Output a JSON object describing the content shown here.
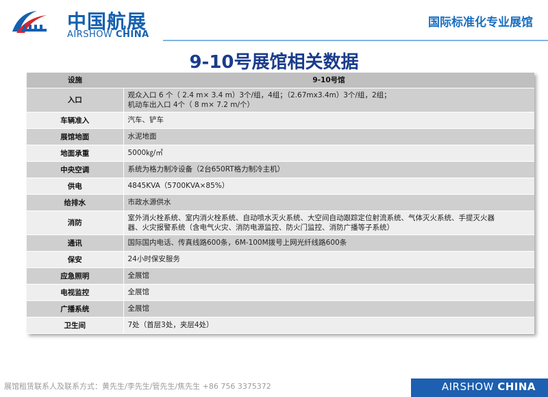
{
  "header": {
    "logo_cn": "中国航展",
    "logo_en_prefix": "AIRSHOW ",
    "logo_en_bold": "CHINA",
    "tagline": "国际标准化专业展馆"
  },
  "title": "9-10号展馆相关数据",
  "table": {
    "col_facility": "设施",
    "col_hall": "9-10号馆",
    "rows": [
      {
        "label": "入口",
        "value_lines": [
          "观众入口 6 个（ 2.4 m× 3.4 m）3个/组，4组；（2.67mx3.4m）3个/组，2组；",
          "机动车出入口 4个（ 8 m× 7.2 m/个）"
        ]
      },
      {
        "label": "车辆准入",
        "value_lines": [
          "汽车、铲车"
        ]
      },
      {
        "label": "展馆地面",
        "value_lines": [
          "水泥地面"
        ]
      },
      {
        "label": "地面承重",
        "value_lines": [
          "5000㎏/㎡"
        ]
      },
      {
        "label": "中央空调",
        "value_lines": [
          "系统为格力制冷设备（2台650RT格力制冷主机）"
        ]
      },
      {
        "label": "供电",
        "value_lines": [
          "4845KVA（5700KVA×85%）"
        ]
      },
      {
        "label": "给排水",
        "value_lines": [
          "市政水源供水"
        ]
      },
      {
        "label": "消防",
        "value_lines": [
          "室外消火栓系统、室内消火栓系统、自动喷水灭火系统、大空间自动跟踪定位射流系统、气体灭火系统、手提灭火器",
          "器、火灾报警系统（含电气火灾、消防电源监控、防火门监控、消防广播等子系统）"
        ]
      },
      {
        "label": "通讯",
        "value_lines": [
          "国际国内电话、传真线路600条，6M-100M拨号上网光纤线路600条"
        ]
      },
      {
        "label": "保安",
        "value_lines": [
          "24小时保安服务"
        ]
      },
      {
        "label": "应急照明",
        "value_lines": [
          "全展馆"
        ]
      },
      {
        "label": "电视监控",
        "value_lines": [
          "全展馆"
        ]
      },
      {
        "label": "广播系统",
        "value_lines": [
          "全展馆"
        ]
      },
      {
        "label": "卫生间",
        "value_lines": [
          "7处（首层3处，夹层4处）"
        ]
      }
    ]
  },
  "footer": {
    "contact": "展馆租赁联系人及联系方式：黄先生/李先生/管先生/焦先生     +86 756 3375372",
    "brand_prefix": "AIRSHOW ",
    "brand_bold": "CHINA"
  },
  "colors": {
    "brand_blue": "#1560b0",
    "title_navy": "#1a3c8c",
    "row_dark": "#cfcfcf",
    "row_light": "#eeeeee",
    "header_gray": "#bfbfbf"
  }
}
